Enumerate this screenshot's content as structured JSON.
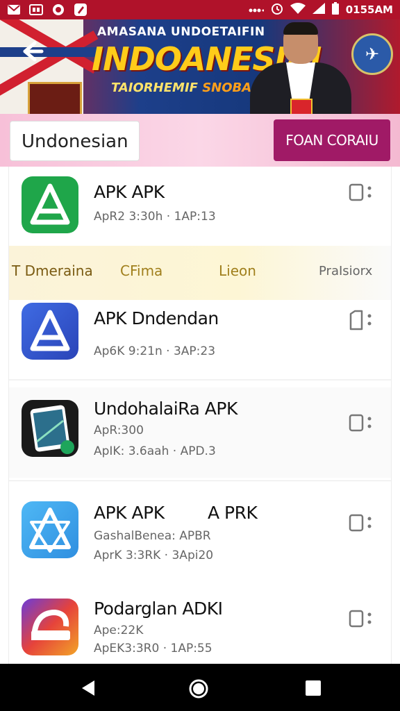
{
  "status_bar": {
    "time": "0155AM",
    "left_icons": [
      "gmail-icon",
      "sim-icon",
      "record-icon",
      "edit-icon"
    ],
    "right_icons": [
      "signal-dots-icon",
      "alarm-icon",
      "wifi-icon",
      "cell-signal-icon",
      "battery-icon"
    ]
  },
  "banner": {
    "top_text": "AMASANA UNDOETAIFIN",
    "main_text": "INDOANESIAI",
    "sub_text_a": "TAIORHEMIF",
    "sub_text_b": "SNOBAS"
  },
  "search": {
    "language_value": "Undonesian",
    "action_label": "FOAN CORAIU"
  },
  "tabs": [
    {
      "label": "T Dmeraina"
    },
    {
      "label": "CFima"
    },
    {
      "label": "Lieon"
    },
    {
      "label": "PraIsiorx"
    }
  ],
  "apps": [
    {
      "title": "APK APK",
      "meta1": "ApR2 3:30h · 1AP:13",
      "meta2": "",
      "icon": "app-logo-green-a-icon"
    },
    {
      "title": "APK Dndendan",
      "meta1": "Ap6K 9:21n · 3AP:23",
      "meta2": "",
      "icon": "app-logo-blue-a-icon"
    },
    {
      "title": "UndohalaiRa APK",
      "meta1": "ApR:300",
      "meta2": "ApIK: 3.6aah · APD.3",
      "icon": "tablet-app-icon"
    },
    {
      "title": "APK APK",
      "title_extra": "A PRK",
      "meta1": "GashalBenea: APBR",
      "meta2": "AprK 3:3RK · 3Api20",
      "icon": "app-logo-light-blue-a-icon"
    },
    {
      "title": "Podarglan ADKI",
      "meta1": "Ape:22K",
      "meta2": "ApEK3:3R0 · 1AP:55",
      "icon": "app-logo-colorful-icon"
    }
  ],
  "colors": {
    "status_bar": "#b0122a",
    "action_button": "#a01a66",
    "search_row": "#f8c6dc"
  }
}
